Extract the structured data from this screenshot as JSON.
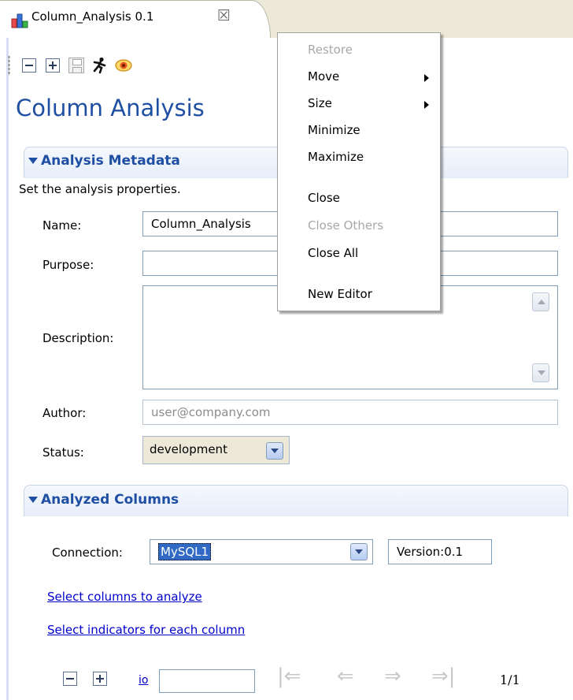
{
  "tab": {
    "title": "Column_Analysis 0.1",
    "close_glyph": "☒"
  },
  "toolbar": {
    "icons": [
      "collapse-all-icon",
      "expand-all-icon",
      "save-icon",
      "run-icon",
      "preview-eye-icon"
    ]
  },
  "page": {
    "title": "Column Analysis"
  },
  "metadata_section": {
    "title": "Analysis Metadata",
    "description": "Set the analysis properties.",
    "name_label": "Name:",
    "name_value": "Column_Analysis",
    "purpose_label": "Purpose:",
    "purpose_value": "",
    "description_label": "Description:",
    "description_value": "",
    "author_label": "Author:",
    "author_value": "user@company.com",
    "status_label": "Status:",
    "status_value": "development"
  },
  "columns_section": {
    "title": "Analyzed Columns",
    "connection_label": "Connection:",
    "connection_value": "MySQL1",
    "version_label": "Version:0.1",
    "select_columns_link": "Select columns to analyze",
    "select_indicators_link": "Select indicators for each column"
  },
  "pager": {
    "go_label": "io",
    "page_input_value": "",
    "first_glyph": "|⇐",
    "prev_glyph": "⇐",
    "next_glyph": "⇒",
    "last_glyph": "⇒|",
    "page_indicator": "1/1"
  },
  "context_menu": {
    "restore": "Restore",
    "move": "Move",
    "size": "Size",
    "minimize": "Minimize",
    "maximize": "Maximize",
    "close": "Close",
    "close_others": "Close Others",
    "close_all": "Close All",
    "new_editor": "New Editor"
  },
  "colors": {
    "accent": "#1f4fa3",
    "link": "#0000cc",
    "disabled_text": "#a8a8a8",
    "selection": "#316ac5"
  }
}
